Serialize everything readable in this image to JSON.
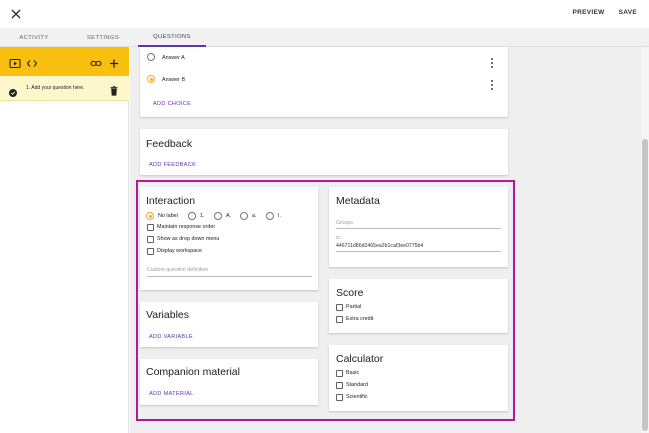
{
  "topbar": {
    "preview_label": "PREVIEW",
    "save_label": "SAVE"
  },
  "tabs": [
    {
      "label": "ACTIVITY",
      "active": false
    },
    {
      "label": "SETTINGS",
      "active": false
    },
    {
      "label": "QUESTIONS",
      "active": true
    }
  ],
  "sidebar": {
    "question_label": "1. Add your question here."
  },
  "choices": {
    "items": [
      {
        "label": "Answer A",
        "selected": false
      },
      {
        "label": "Answer B",
        "selected": true
      }
    ],
    "add_label": "ADD CHOICE"
  },
  "feedback": {
    "title": "Feedback",
    "add_label": "ADD FEEDBACK"
  },
  "interaction": {
    "title": "Interaction",
    "label_options": [
      {
        "label": "No label",
        "selected": true
      },
      {
        "label": "1.",
        "selected": false
      },
      {
        "label": "A.",
        "selected": false
      },
      {
        "label": "a.",
        "selected": false
      },
      {
        "label": "I.",
        "selected": false
      }
    ],
    "checkboxes": [
      "Maintain response order",
      "Show as drop down menu",
      "Display workspace"
    ],
    "custom_definition_placeholder": "Custom question definition"
  },
  "variables": {
    "title": "Variables",
    "add_label": "ADD VARIABLE"
  },
  "companion": {
    "title": "Companion material",
    "add_label": "ADD MATERIAL"
  },
  "metadata": {
    "title": "Metadata",
    "groups_placeholder": "Groups",
    "id_label": "ID",
    "id_value": "446711d86d2465ea2b1caf3ee0775b4"
  },
  "score": {
    "title": "Score",
    "options": [
      "Partial",
      "Extra credit"
    ]
  },
  "calculator": {
    "title": "Calculator",
    "options": [
      "Basic",
      "Standard",
      "Scientific"
    ]
  },
  "colors": {
    "accent": "#5e35b1",
    "toolbar": "#f9bf0f",
    "highlight": "#b0199a",
    "selected_radio": "#f9a825"
  }
}
